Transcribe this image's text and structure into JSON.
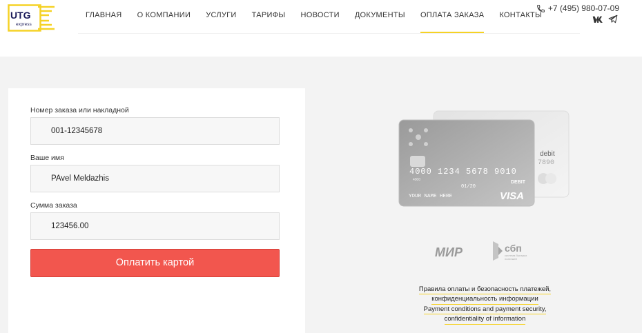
{
  "logo": {
    "brand": "UTG",
    "sub": "express"
  },
  "nav": [
    "ГЛАВНАЯ",
    "О КОМПАНИИ",
    "УСЛУГИ",
    "ТАРИФЫ",
    "НОВОСТИ",
    "ДОКУМЕНТЫ",
    "ОПЛАТА ЗАКАЗА",
    "КОНТАКТЫ"
  ],
  "nav_active": "ОПЛАТА ЗАКАЗА",
  "phone": "+7 (495) 980-07-09",
  "form": {
    "order_label": "Номер заказа или накладной",
    "order_value": "001-12345678",
    "name_label": "Ваше имя",
    "name_value": "PAvel Meldazhis",
    "amount_label": "Сумма заказа",
    "amount_value": "123456.00",
    "pay_button": "Оплатить картой"
  },
  "cards": {
    "front_number": "4000 1234 5678 9010",
    "front_small": "4000",
    "front_expiry": "01/20",
    "front_name": "YOUR NAME HERE",
    "front_type": "DEBIT",
    "front_brand": "VISA",
    "back_type": "debit",
    "back_number": "7890"
  },
  "payment_logos": {
    "mir": "МИР",
    "sbp": "сбп",
    "sbp_sub1": "система быстрых",
    "sbp_sub2": "платежей"
  },
  "links": {
    "line1": "Правила оплаты и безопасность платежей,",
    "line2": "конфиденциальность информации",
    "line3": "Payment conditions and payment security,",
    "line4": "confidentiality of information"
  },
  "colors": {
    "accent": "#f5d225",
    "button": "#f2564e"
  }
}
